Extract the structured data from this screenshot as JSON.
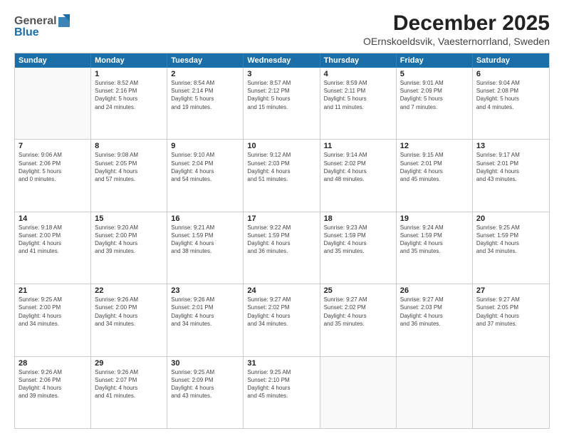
{
  "logo": {
    "line1": "General",
    "line2": "Blue"
  },
  "title": "December 2025",
  "subtitle": "OErnskoeldsvik, Vaesternorrland, Sweden",
  "days": [
    "Sunday",
    "Monday",
    "Tuesday",
    "Wednesday",
    "Thursday",
    "Friday",
    "Saturday"
  ],
  "weeks": [
    [
      {
        "num": "",
        "info": ""
      },
      {
        "num": "1",
        "info": "Sunrise: 8:52 AM\nSunset: 2:16 PM\nDaylight: 5 hours\nand 24 minutes."
      },
      {
        "num": "2",
        "info": "Sunrise: 8:54 AM\nSunset: 2:14 PM\nDaylight: 5 hours\nand 19 minutes."
      },
      {
        "num": "3",
        "info": "Sunrise: 8:57 AM\nSunset: 2:12 PM\nDaylight: 5 hours\nand 15 minutes."
      },
      {
        "num": "4",
        "info": "Sunrise: 8:59 AM\nSunset: 2:11 PM\nDaylight: 5 hours\nand 11 minutes."
      },
      {
        "num": "5",
        "info": "Sunrise: 9:01 AM\nSunset: 2:09 PM\nDaylight: 5 hours\nand 7 minutes."
      },
      {
        "num": "6",
        "info": "Sunrise: 9:04 AM\nSunset: 2:08 PM\nDaylight: 5 hours\nand 4 minutes."
      }
    ],
    [
      {
        "num": "7",
        "info": "Sunrise: 9:06 AM\nSunset: 2:06 PM\nDaylight: 5 hours\nand 0 minutes."
      },
      {
        "num": "8",
        "info": "Sunrise: 9:08 AM\nSunset: 2:05 PM\nDaylight: 4 hours\nand 57 minutes."
      },
      {
        "num": "9",
        "info": "Sunrise: 9:10 AM\nSunset: 2:04 PM\nDaylight: 4 hours\nand 54 minutes."
      },
      {
        "num": "10",
        "info": "Sunrise: 9:12 AM\nSunset: 2:03 PM\nDaylight: 4 hours\nand 51 minutes."
      },
      {
        "num": "11",
        "info": "Sunrise: 9:14 AM\nSunset: 2:02 PM\nDaylight: 4 hours\nand 48 minutes."
      },
      {
        "num": "12",
        "info": "Sunrise: 9:15 AM\nSunset: 2:01 PM\nDaylight: 4 hours\nand 45 minutes."
      },
      {
        "num": "13",
        "info": "Sunrise: 9:17 AM\nSunset: 2:01 PM\nDaylight: 4 hours\nand 43 minutes."
      }
    ],
    [
      {
        "num": "14",
        "info": "Sunrise: 9:18 AM\nSunset: 2:00 PM\nDaylight: 4 hours\nand 41 minutes."
      },
      {
        "num": "15",
        "info": "Sunrise: 9:20 AM\nSunset: 2:00 PM\nDaylight: 4 hours\nand 39 minutes."
      },
      {
        "num": "16",
        "info": "Sunrise: 9:21 AM\nSunset: 1:59 PM\nDaylight: 4 hours\nand 38 minutes."
      },
      {
        "num": "17",
        "info": "Sunrise: 9:22 AM\nSunset: 1:59 PM\nDaylight: 4 hours\nand 36 minutes."
      },
      {
        "num": "18",
        "info": "Sunrise: 9:23 AM\nSunset: 1:59 PM\nDaylight: 4 hours\nand 35 minutes."
      },
      {
        "num": "19",
        "info": "Sunrise: 9:24 AM\nSunset: 1:59 PM\nDaylight: 4 hours\nand 35 minutes."
      },
      {
        "num": "20",
        "info": "Sunrise: 9:25 AM\nSunset: 1:59 PM\nDaylight: 4 hours\nand 34 minutes."
      }
    ],
    [
      {
        "num": "21",
        "info": "Sunrise: 9:25 AM\nSunset: 2:00 PM\nDaylight: 4 hours\nand 34 minutes."
      },
      {
        "num": "22",
        "info": "Sunrise: 9:26 AM\nSunset: 2:00 PM\nDaylight: 4 hours\nand 34 minutes."
      },
      {
        "num": "23",
        "info": "Sunrise: 9:26 AM\nSunset: 2:01 PM\nDaylight: 4 hours\nand 34 minutes."
      },
      {
        "num": "24",
        "info": "Sunrise: 9:27 AM\nSunset: 2:02 PM\nDaylight: 4 hours\nand 34 minutes."
      },
      {
        "num": "25",
        "info": "Sunrise: 9:27 AM\nSunset: 2:02 PM\nDaylight: 4 hours\nand 35 minutes."
      },
      {
        "num": "26",
        "info": "Sunrise: 9:27 AM\nSunset: 2:03 PM\nDaylight: 4 hours\nand 36 minutes."
      },
      {
        "num": "27",
        "info": "Sunrise: 9:27 AM\nSunset: 2:05 PM\nDaylight: 4 hours\nand 37 minutes."
      }
    ],
    [
      {
        "num": "28",
        "info": "Sunrise: 9:26 AM\nSunset: 2:06 PM\nDaylight: 4 hours\nand 39 minutes."
      },
      {
        "num": "29",
        "info": "Sunrise: 9:26 AM\nSunset: 2:07 PM\nDaylight: 4 hours\nand 41 minutes."
      },
      {
        "num": "30",
        "info": "Sunrise: 9:25 AM\nSunset: 2:09 PM\nDaylight: 4 hours\nand 43 minutes."
      },
      {
        "num": "31",
        "info": "Sunrise: 9:25 AM\nSunset: 2:10 PM\nDaylight: 4 hours\nand 45 minutes."
      },
      {
        "num": "",
        "info": ""
      },
      {
        "num": "",
        "info": ""
      },
      {
        "num": "",
        "info": ""
      }
    ]
  ]
}
